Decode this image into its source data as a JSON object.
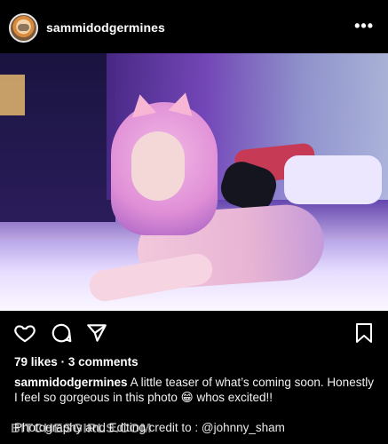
{
  "post": {
    "username": "sammidodgermines",
    "more_label": "•••"
  },
  "photo": {
    "alt_icon": "photo-image"
  },
  "actions": {
    "like_icon": "heart-icon",
    "comment_icon": "comment-icon",
    "share_icon": "send-icon",
    "save_icon": "bookmark-icon"
  },
  "stats": {
    "likes_text": "79 likes",
    "separator": "·",
    "comments_text": "3 comments"
  },
  "caption": {
    "username": "sammidodgermines",
    "text": "A little teaser of what’s coming soon. Honestly I feel so gorgeous in this photo 😁 whos excited!!",
    "credit": "Photography and Editing credit to : @johnny_sham"
  },
  "watermark": {
    "text": "BITCHESGIRLS.COM"
  },
  "colors": {
    "background": "#000000",
    "text": "#ffffff"
  }
}
